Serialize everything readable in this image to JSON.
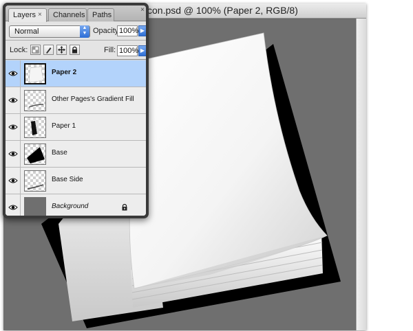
{
  "document": {
    "title": "con.psd @ 100% (Paper 2, RGB/8)"
  },
  "layers_panel": {
    "tabs": [
      {
        "label": "Layers",
        "active": true
      },
      {
        "label": "Channels",
        "active": false
      },
      {
        "label": "Paths",
        "active": false
      }
    ],
    "tab_close_glyph": "×",
    "panel_close_glyph": "×",
    "blend_mode": "Normal",
    "opacity_label": "Opacity:",
    "opacity_value": "100%",
    "lock_label": "Lock:",
    "fill_label": "Fill:",
    "fill_value": "100%",
    "lock_buttons": [
      "lock-transparent-icon",
      "lock-brush-icon",
      "lock-move-icon",
      "lock-all-icon"
    ],
    "layers": [
      {
        "name": "Paper 2",
        "selected": true,
        "visible": true
      },
      {
        "name": "Other Pages's Gradient Fill co...",
        "selected": false,
        "visible": true
      },
      {
        "name": "Paper 1",
        "selected": false,
        "visible": true
      },
      {
        "name": "Base",
        "selected": false,
        "visible": true
      },
      {
        "name": "Base Side",
        "selected": false,
        "visible": true
      },
      {
        "name": "Background",
        "selected": false,
        "visible": true,
        "locked": true
      }
    ]
  },
  "colors": {
    "canvas_bg": "#6f6f6f",
    "selection": "#b3d3fb",
    "panel_frame": "#3a3a3a"
  }
}
